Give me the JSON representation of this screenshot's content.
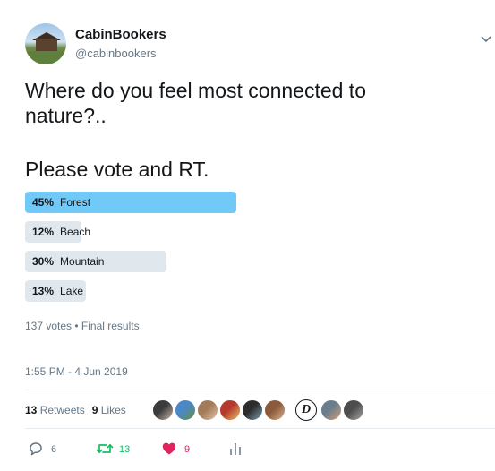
{
  "account": {
    "display_name": "CabinBookers",
    "handle": "@cabinbookers"
  },
  "tweet": {
    "text_lines": [
      "Where do you feel most connected to\nnature?..",
      "Please vote and RT."
    ]
  },
  "poll": {
    "options": [
      {
        "percent_label": "45%",
        "label": "Forest",
        "percent": 45,
        "winner": true
      },
      {
        "percent_label": "12%",
        "label": "Beach",
        "percent": 12,
        "winner": false
      },
      {
        "percent_label": "30%",
        "label": "Mountain",
        "percent": 30,
        "winner": false
      },
      {
        "percent_label": "13%",
        "label": "Lake",
        "percent": 13,
        "winner": false
      }
    ],
    "meta": "137 votes • Final results"
  },
  "timestamp": "1:55 PM - 4 Jun 2019",
  "stats": {
    "retweets_count": "13",
    "retweets_label": "Retweets",
    "likes_count": "9",
    "likes_label": "Likes"
  },
  "likers": [
    {
      "colors": [
        "#3b3b3b",
        "#c9b9a8"
      ]
    },
    {
      "colors": [
        "#4a88c8",
        "#6b8f3c"
      ]
    },
    {
      "colors": [
        "#a37a5a",
        "#e0c4a8"
      ]
    },
    {
      "colors": [
        "#b53a2c",
        "#e8c26a"
      ]
    },
    {
      "colors": [
        "#2d2d2d",
        "#7aa0b8"
      ]
    },
    {
      "colors": [
        "#8a5a3a",
        "#d8b090"
      ]
    },
    {
      "letter": "D"
    },
    {
      "colors": [
        "#6a7d8c",
        "#d4a07a"
      ]
    },
    {
      "colors": [
        "#4d4d4d",
        "#a8a8a8"
      ]
    }
  ],
  "actions": {
    "reply_count": "6",
    "retweet_count": "13",
    "like_count": "9"
  },
  "colors": {
    "retweet_green": "#17bf63",
    "like_red": "#e0245e",
    "secondary_gray": "#657786",
    "poll_winner_blue": "#71c9f8",
    "poll_bar_gray": "#e1e8ed"
  },
  "icons": [
    "chevron-down-icon",
    "reply-icon",
    "retweet-icon",
    "heart-icon",
    "analytics-icon"
  ]
}
